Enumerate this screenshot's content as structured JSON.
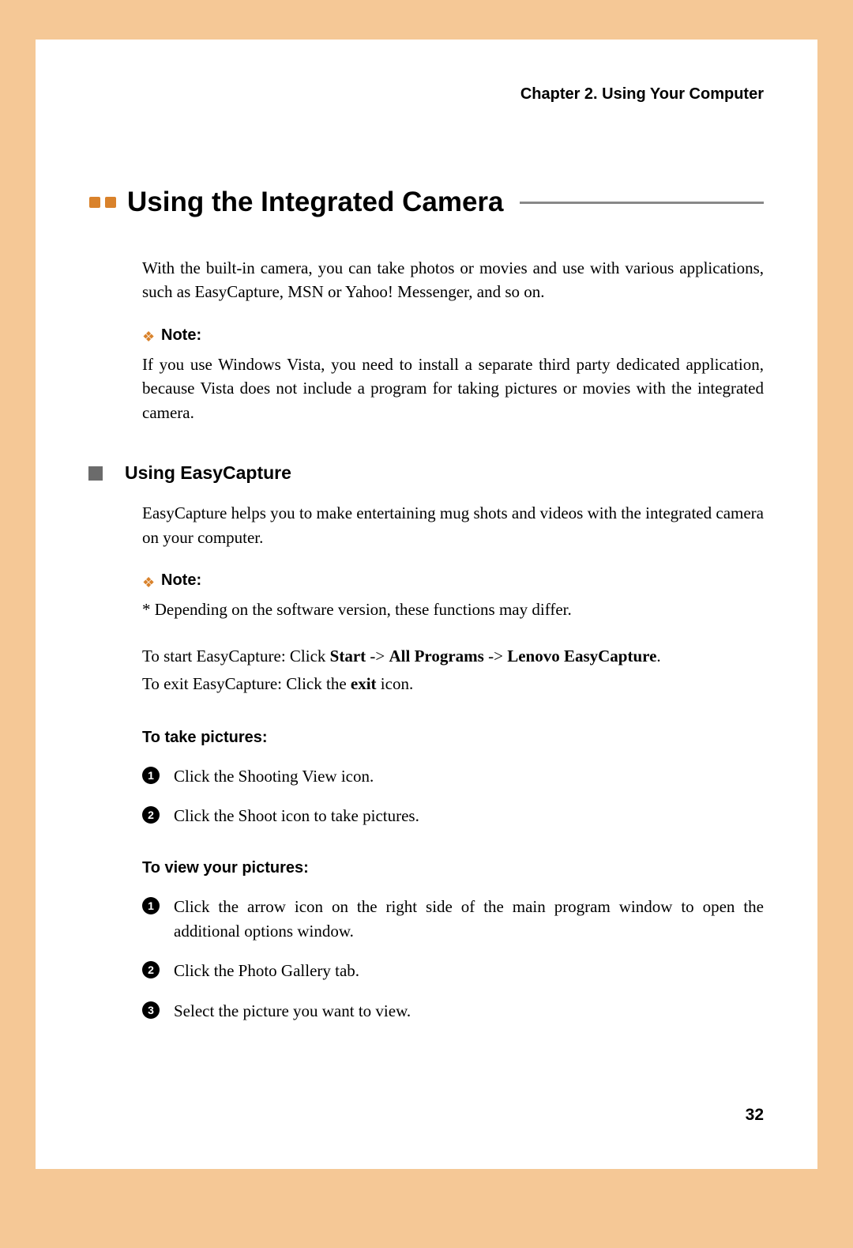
{
  "header": "Chapter 2. Using Your Computer",
  "section_title": "Using the Integrated Camera",
  "intro": "With the built-in camera, you can take photos or movies and use with various applications, such as EasyCapture, MSN or Yahoo! Messenger, and so on.",
  "note1_label": "Note:",
  "note1_text": "If you use Windows Vista, you need to install a separate third party dedicated application, because Vista does not include a program for taking pictures or movies with the integrated camera.",
  "sub1_title": "Using EasyCapture",
  "sub1_intro": "EasyCapture helps you to make entertaining mug shots and videos with the integrated camera on your computer.",
  "note2_label": "Note:",
  "note2_text": "* Depending on the software version, these functions may differ.",
  "start_prefix": "To start EasyCapture: Click ",
  "start_b1": "Start",
  "start_mid1": " -> ",
  "start_b2": "All Programs",
  "start_mid2": " -> ",
  "start_b3": "Lenovo EasyCapture",
  "start_suffix": ".",
  "exit_prefix": "To exit EasyCapture: Click the ",
  "exit_b1": "exit",
  "exit_suffix": " icon.",
  "heading_take": "To take pictures:",
  "take_steps": [
    "Click the Shooting View icon.",
    "Click the Shoot icon to take pictures."
  ],
  "heading_view": "To view your pictures:",
  "view_steps": [
    "Click the arrow icon on the right side of the main program window to open the additional options window.",
    "Click the Photo Gallery tab.",
    "Select the picture you want to view."
  ],
  "page_number": "32"
}
